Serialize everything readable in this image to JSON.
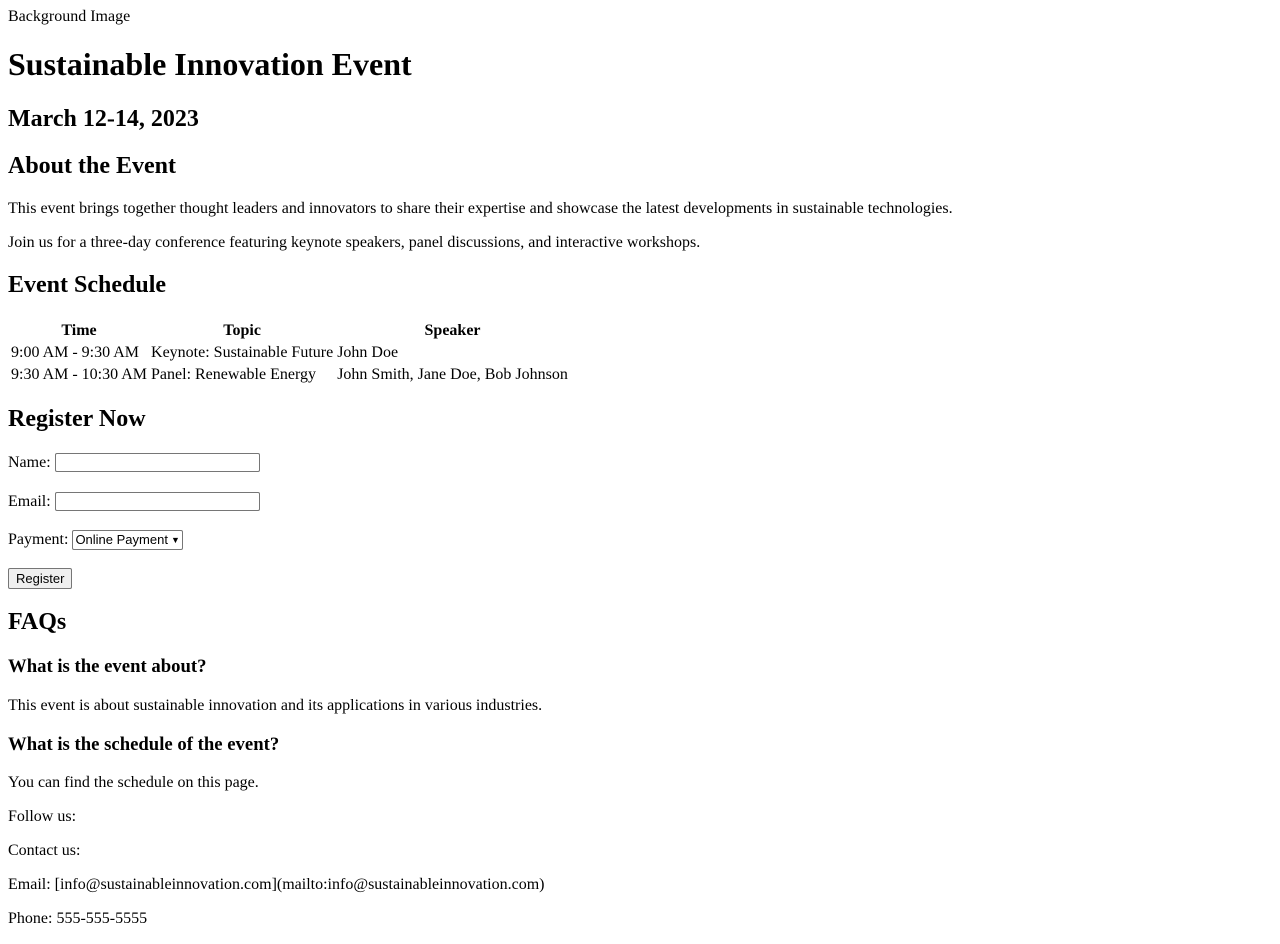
{
  "background_image": {
    "alt": "Background Image"
  },
  "header": {
    "title": "Sustainable Innovation Event",
    "date": "March 12-14, 2023"
  },
  "about": {
    "heading": "About the Event",
    "paragraphs": [
      "This event brings together thought leaders and innovators to share their expertise and showcase the latest developments in sustainable technologies.",
      "Join us for a three-day conference featuring keynote speakers, panel discussions, and interactive workshops."
    ]
  },
  "schedule": {
    "heading": "Event Schedule",
    "columns": [
      "Time",
      "Topic",
      "Speaker"
    ],
    "rows": [
      [
        "9:00 AM - 9:30 AM",
        "Keynote: Sustainable Future",
        "John Doe"
      ],
      [
        "9:30 AM - 10:30 AM",
        "Panel: Renewable Energy",
        "John Smith, Jane Doe, Bob Johnson"
      ]
    ]
  },
  "register": {
    "heading": "Register Now",
    "name_label": "Name:",
    "name_value": "",
    "email_label": "Email:",
    "email_value": "",
    "payment_label": "Payment:",
    "payment_selected": "Online Payment",
    "submit_label": "Register"
  },
  "faqs": {
    "heading": "FAQs",
    "items": [
      {
        "q": "What is the event about?",
        "a": "This event is about sustainable innovation and its applications in various industries."
      },
      {
        "q": "What is the schedule of the event?",
        "a": "You can find the schedule on this page."
      }
    ]
  },
  "footer": {
    "follow": "Follow us:",
    "contact": "Contact us:",
    "email_line": "Email: [info@sustainableinnovation.com](mailto:info@sustainableinnovation.com)",
    "phone_line": "Phone: 555-555-5555"
  }
}
